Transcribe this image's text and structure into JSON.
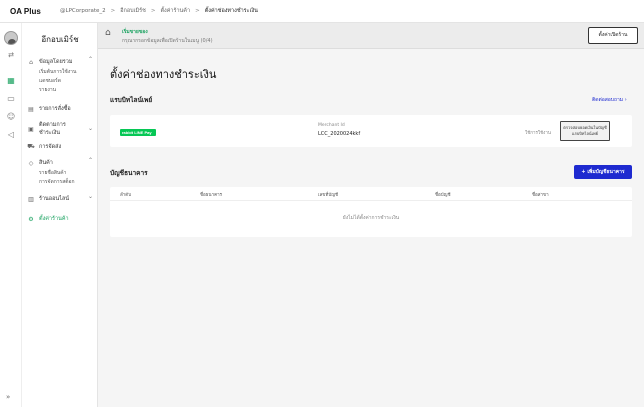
{
  "app": {
    "logo": "OA Plus"
  },
  "breadcrumb": [
    "@LPCorporate_2",
    "อีกอบเมิร์ช",
    "ตั้งค่าร้านค้า",
    "ตั้งค่าช่องทางชำระเงิน"
  ],
  "sidebar": {
    "title": "อีกอบเมิร์ช",
    "items": [
      {
        "label": "ข้อมูลโดยรวม",
        "icon": "home-icon",
        "sub": [
          "เริ่มต้นการใช้งาน",
          "แดชบอร์ด",
          "รายงาน"
        ]
      },
      {
        "label": "รายการสั่งซื้อ",
        "icon": "order-icon"
      },
      {
        "label": "ติดตามการชำระเงิน",
        "icon": "payment-icon"
      },
      {
        "label": "การจัดส่ง",
        "icon": "truck-icon"
      },
      {
        "label": "สินค้า",
        "icon": "tag-icon",
        "sub": [
          "รายชื่อสินค้า",
          "การจัดการสต็อก"
        ]
      },
      {
        "label": "ร้านออนไลน์",
        "icon": "store-icon"
      },
      {
        "label": "ตั้งค่าร้านค้า",
        "icon": "gear-icon"
      }
    ]
  },
  "banner": {
    "title": "เริ่มขายของ",
    "subtitle": "กรุณากรอกข้อมูลเพื่อเปิดร้านในเมนู (0/4)",
    "button": "ตั้งค่าเปิดร้าน"
  },
  "page": {
    "title": "ตั้งค่าช่องทางชำระเงิน"
  },
  "payment": {
    "section_title": "แรบบิทไลน์เพย์",
    "link": "ติดต่อสอบถาม",
    "logo_text": "rabbit LINE Pay",
    "merchant_label": "Merchant Id",
    "merchant_value": "LCC_2020024kkf",
    "status": "ใช้การใช้งาน",
    "action_button": "ตรวจสอบยอดเงินในบัญชีแรบบิทไลน์เพย์"
  },
  "bank": {
    "section_title": "บัญชีธนาคาร",
    "add_button": "เพิ่มบัญชีธนาคาร",
    "columns": [
      "ลำดับ",
      "ชื่อธนาคาร",
      "เลขที่บัญชี",
      "ชื่อบัญชี",
      "ชื่อสาขา"
    ],
    "empty_text": "ยังไม่ได้ตั้งค่าการชำระเงิน"
  },
  "colors": {
    "accent": "#1aa260",
    "primary": "#1e2ad0",
    "linepay": "#06c755"
  }
}
